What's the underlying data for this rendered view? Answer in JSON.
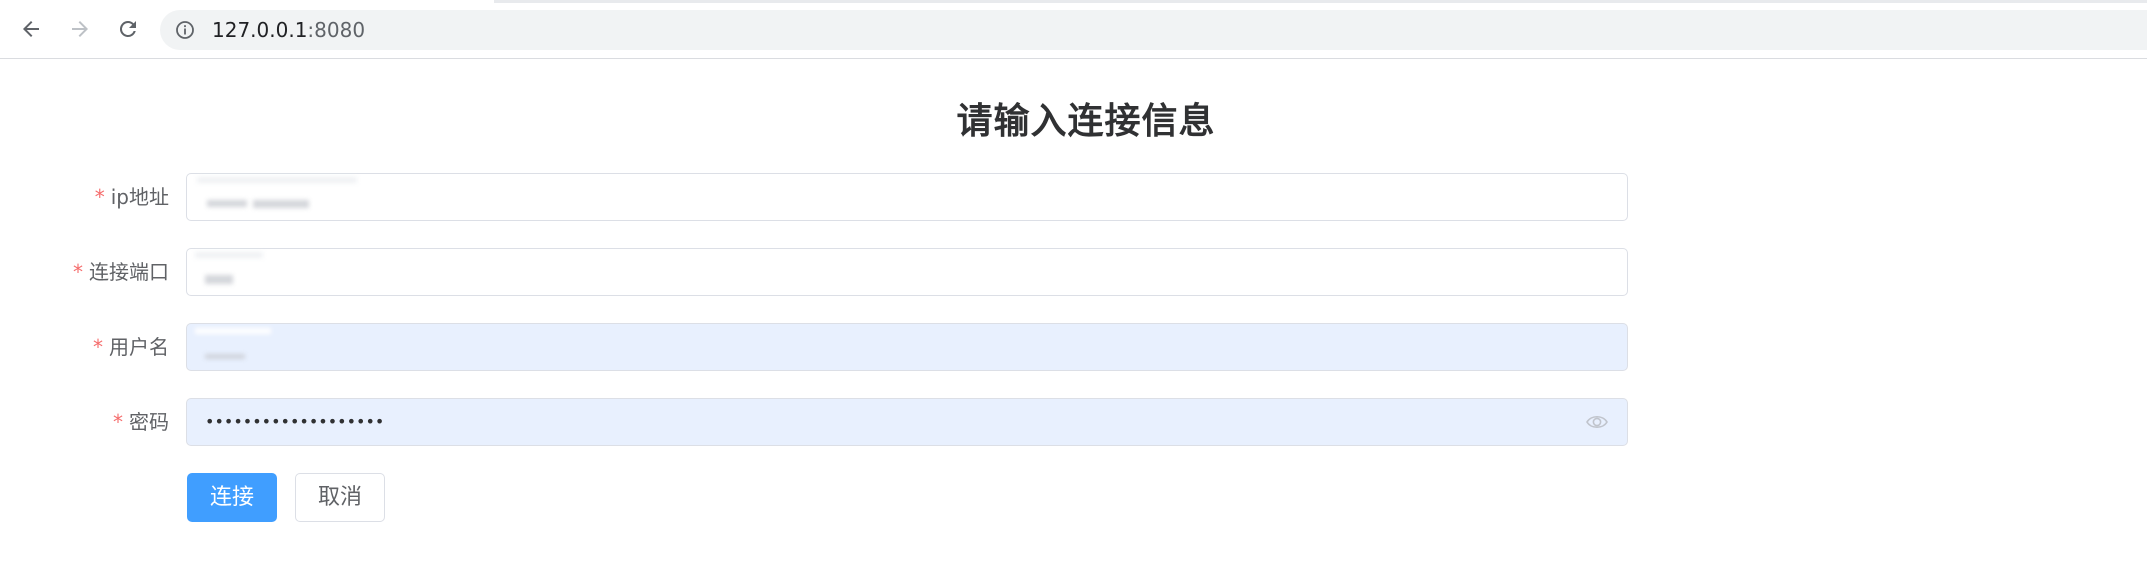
{
  "browser": {
    "url_host": "127.0.0.1",
    "url_port": ":8080"
  },
  "form": {
    "title": "请输入连接信息",
    "fields": [
      {
        "label": "ip地址",
        "required_mark": "*",
        "value": ""
      },
      {
        "label": "连接端口",
        "required_mark": "*",
        "value": ""
      },
      {
        "label": "用户名",
        "required_mark": "*",
        "value": ""
      },
      {
        "label": "密码",
        "required_mark": "*",
        "value": "•••••••••••••••••••"
      }
    ],
    "connect_label": "连接",
    "cancel_label": "取消"
  },
  "colors": {
    "primary": "#409eff",
    "required": "#f56c6c",
    "autofill_bg": "#e8f0fe",
    "title": "#303133"
  },
  "icons": {
    "back": "back-arrow-icon",
    "forward": "forward-arrow-icon",
    "reload": "reload-icon",
    "site_info": "info-icon",
    "password_toggle": "eye-icon"
  }
}
